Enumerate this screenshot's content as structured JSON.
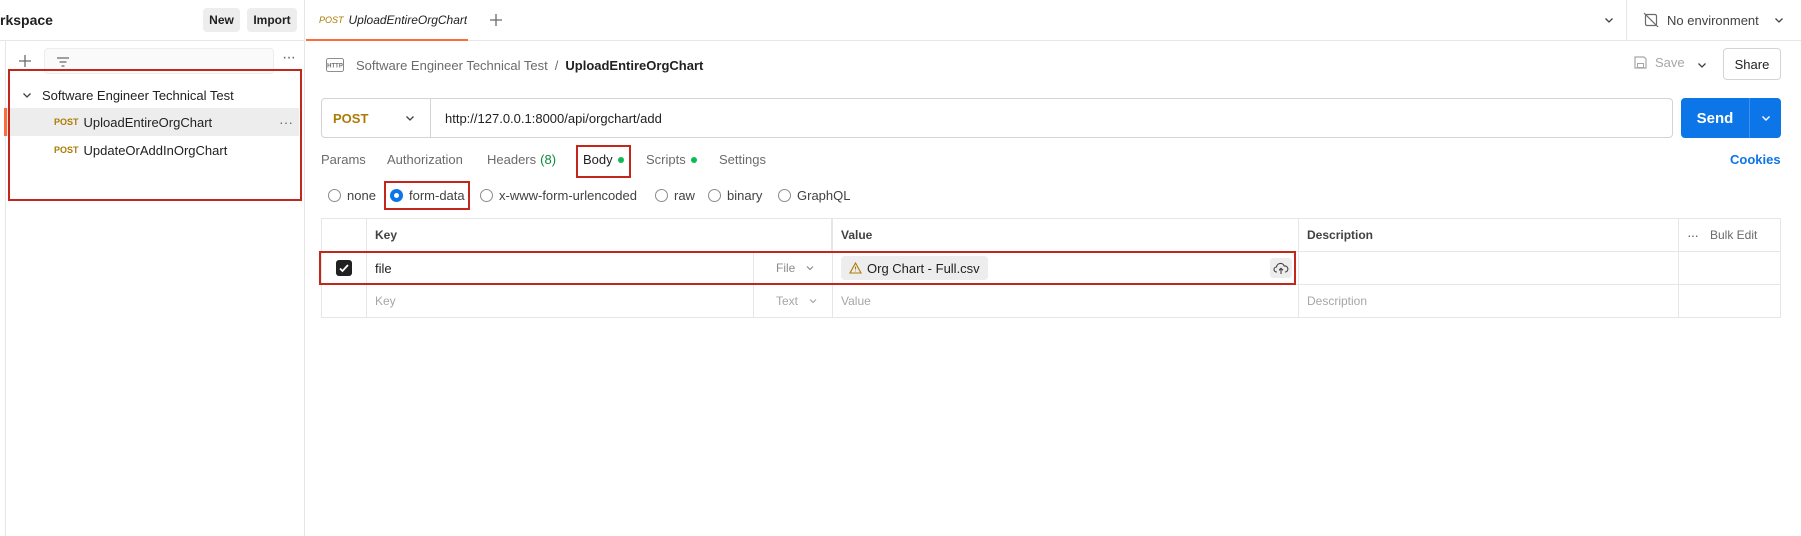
{
  "workspace": {
    "title": "rkspace",
    "new_label": "New",
    "import_label": "Import"
  },
  "sidebar": {
    "collection_name": "Software Engineer Technical Test",
    "requests": [
      {
        "method": "POST",
        "name": "UploadEntireOrgChart",
        "active": true
      },
      {
        "method": "POST",
        "name": "UpdateOrAddInOrgChart",
        "active": false
      }
    ]
  },
  "tabs": {
    "open": [
      {
        "method": "POST",
        "name": "UploadEntireOrgChart"
      }
    ],
    "environment": "No environment"
  },
  "breadcrumb": {
    "collection": "Software Engineer Technical Test",
    "separator": "/",
    "request": "UploadEntireOrgChart"
  },
  "actions": {
    "save_label": "Save",
    "share_label": "Share"
  },
  "request": {
    "method": "POST",
    "url": "http://127.0.0.1:8000/api/orgchart/add",
    "send_label": "Send"
  },
  "request_tabs": {
    "params": "Params",
    "authorization": "Authorization",
    "headers": "Headers",
    "headers_count": "(8)",
    "body": "Body",
    "scripts": "Scripts",
    "settings": "Settings",
    "cookies": "Cookies"
  },
  "body_types": {
    "none": "none",
    "form_data": "form-data",
    "urlencoded": "x-www-form-urlencoded",
    "raw": "raw",
    "binary": "binary",
    "graphql": "GraphQL",
    "selected": "form-data"
  },
  "form_table": {
    "headers": {
      "key": "Key",
      "value": "Value",
      "description": "Description",
      "bulk_edit": "Bulk Edit"
    },
    "rows": [
      {
        "checked": true,
        "key": "file",
        "type": "File",
        "value": "Org Chart - Full.csv",
        "description": ""
      }
    ],
    "placeholder": {
      "key": "Key",
      "type": "Text",
      "value": "Value",
      "description": "Description"
    }
  },
  "colors": {
    "accent": "#ff6c37",
    "send": "#0c75e8",
    "post": "#ad7a03",
    "highlight_box": "#c3271c",
    "status_dot": "#0cbb52"
  }
}
